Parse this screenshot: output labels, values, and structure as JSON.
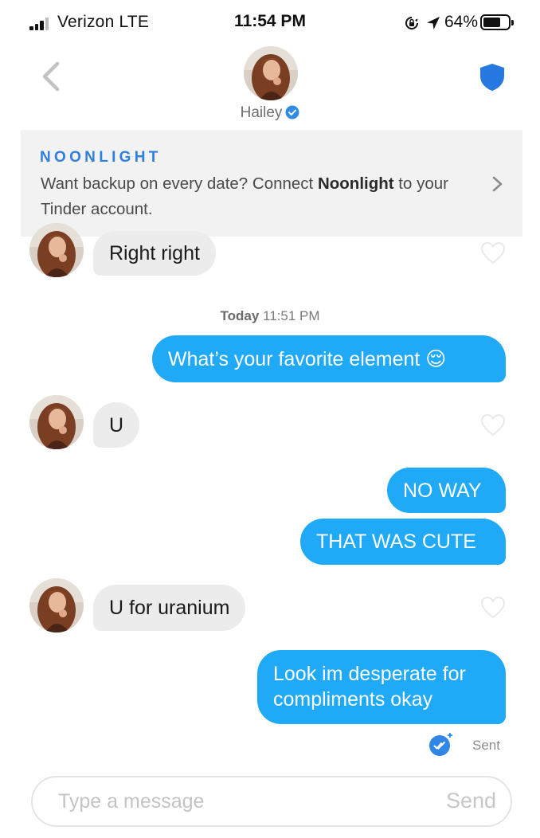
{
  "status_bar": {
    "carrier": "Verizon  LTE",
    "time": "11:54 PM",
    "battery": "64%"
  },
  "header": {
    "match_name": "Hailey",
    "back_icon": "chevron-left-icon",
    "safety_icon": "shield-icon"
  },
  "banner": {
    "brand": "NOONLIGHT",
    "text_before": "Want backup on every date? Connect ",
    "text_bold": "Noonlight",
    "text_after": " to your Tinder account."
  },
  "timestamp": {
    "day": "Today",
    "time": "11:51 PM"
  },
  "messages": [
    {
      "from": "match",
      "text": "Right right"
    },
    {
      "from": "me",
      "text": "What’s your favorite element 😌"
    },
    {
      "from": "match",
      "text": "U"
    },
    {
      "from": "me",
      "text": "NO WAY"
    },
    {
      "from": "me",
      "text": "THAT WAS CUTE"
    },
    {
      "from": "match",
      "text": "U for uranium"
    },
    {
      "from": "me",
      "text": "Look im desperate for compliments okay"
    }
  ],
  "receipt": {
    "status": "Sent"
  },
  "composer": {
    "placeholder": "Type a message",
    "send_label": "Send"
  },
  "colors": {
    "outgoing_bubble": "#1fa9f6",
    "incoming_bubble": "#ececec",
    "brand_blue": "#2f7fdc",
    "banner_bg": "#f2f2f2"
  }
}
